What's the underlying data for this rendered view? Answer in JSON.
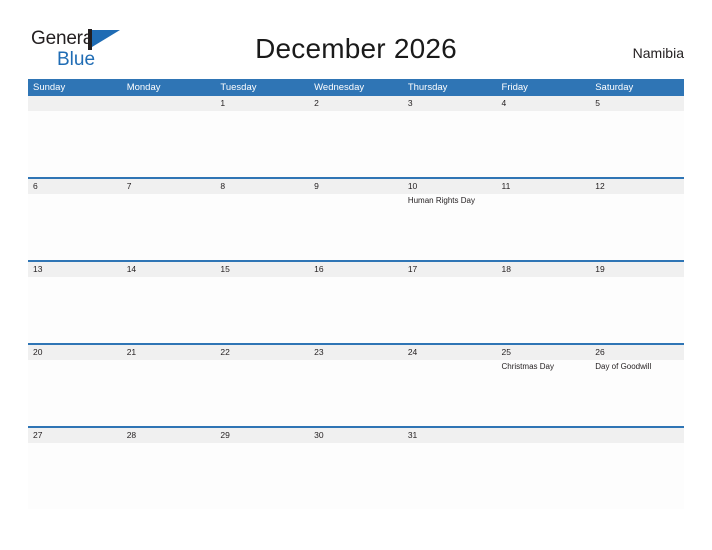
{
  "brand": {
    "name_part1": "General",
    "name_part2": "Blue",
    "accent_color": "#1f6cb4",
    "flag_icon": "flag-triangle-icon"
  },
  "header": {
    "title": "December 2026",
    "country": "Namibia"
  },
  "calendar": {
    "header_bg_color": "#2f75b5",
    "band_bg_color": "#f0f0f0",
    "divider_color": "#2f75b5",
    "day_headers": [
      "Sunday",
      "Monday",
      "Tuesday",
      "Wednesday",
      "Thursday",
      "Friday",
      "Saturday"
    ],
    "weeks": [
      {
        "days": [
          {
            "num": "",
            "event": ""
          },
          {
            "num": "",
            "event": ""
          },
          {
            "num": "1",
            "event": ""
          },
          {
            "num": "2",
            "event": ""
          },
          {
            "num": "3",
            "event": ""
          },
          {
            "num": "4",
            "event": ""
          },
          {
            "num": "5",
            "event": ""
          }
        ]
      },
      {
        "days": [
          {
            "num": "6",
            "event": ""
          },
          {
            "num": "7",
            "event": ""
          },
          {
            "num": "8",
            "event": ""
          },
          {
            "num": "9",
            "event": ""
          },
          {
            "num": "10",
            "event": "Human Rights Day"
          },
          {
            "num": "11",
            "event": ""
          },
          {
            "num": "12",
            "event": ""
          }
        ]
      },
      {
        "days": [
          {
            "num": "13",
            "event": ""
          },
          {
            "num": "14",
            "event": ""
          },
          {
            "num": "15",
            "event": ""
          },
          {
            "num": "16",
            "event": ""
          },
          {
            "num": "17",
            "event": ""
          },
          {
            "num": "18",
            "event": ""
          },
          {
            "num": "19",
            "event": ""
          }
        ]
      },
      {
        "days": [
          {
            "num": "20",
            "event": ""
          },
          {
            "num": "21",
            "event": ""
          },
          {
            "num": "22",
            "event": ""
          },
          {
            "num": "23",
            "event": ""
          },
          {
            "num": "24",
            "event": ""
          },
          {
            "num": "25",
            "event": "Christmas Day"
          },
          {
            "num": "26",
            "event": "Day of Goodwill"
          }
        ]
      },
      {
        "days": [
          {
            "num": "27",
            "event": ""
          },
          {
            "num": "28",
            "event": ""
          },
          {
            "num": "29",
            "event": ""
          },
          {
            "num": "30",
            "event": ""
          },
          {
            "num": "31",
            "event": ""
          },
          {
            "num": "",
            "event": ""
          },
          {
            "num": "",
            "event": ""
          }
        ]
      }
    ]
  }
}
